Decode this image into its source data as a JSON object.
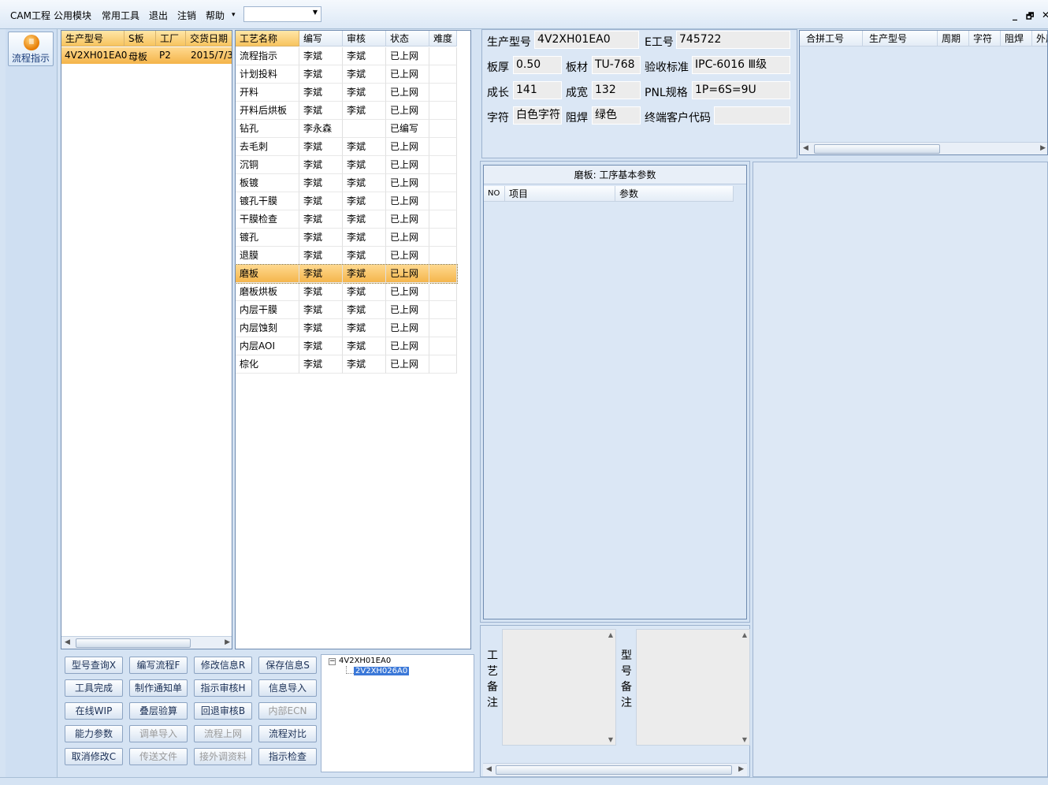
{
  "menu": {
    "items": [
      "CAM工程",
      "公用模块",
      "常用工具",
      "退出",
      "注销",
      "帮助"
    ],
    "more_arrow": "▾",
    "combo_value": "",
    "window_controls": [
      "_",
      "🗗",
      "✕"
    ]
  },
  "left_strip": {
    "flow_button_label": "流程指示"
  },
  "model_grid": {
    "columns": [
      "生产型号",
      "S板",
      "工厂",
      "交货日期"
    ],
    "rows": [
      [
        "4V2XH01EA0",
        "母板",
        "P2",
        "2015/7/3"
      ]
    ]
  },
  "process_grid": {
    "columns": [
      "工艺名称",
      "编写",
      "审核",
      "状态",
      "难度"
    ],
    "rows": [
      [
        "流程指示",
        "李斌",
        "李斌",
        "已上网",
        ""
      ],
      [
        "计划投料",
        "李斌",
        "李斌",
        "已上网",
        ""
      ],
      [
        "开料",
        "李斌",
        "李斌",
        "已上网",
        ""
      ],
      [
        "开料后烘板",
        "李斌",
        "李斌",
        "已上网",
        ""
      ],
      [
        "钻孔",
        "李永森",
        "",
        "已编写",
        ""
      ],
      [
        "去毛刺",
        "李斌",
        "李斌",
        "已上网",
        ""
      ],
      [
        "沉铜",
        "李斌",
        "李斌",
        "已上网",
        ""
      ],
      [
        "板镀",
        "李斌",
        "李斌",
        "已上网",
        ""
      ],
      [
        "镀孔干膜",
        "李斌",
        "李斌",
        "已上网",
        ""
      ],
      [
        "干膜检查",
        "李斌",
        "李斌",
        "已上网",
        ""
      ],
      [
        "镀孔",
        "李斌",
        "李斌",
        "已上网",
        ""
      ],
      [
        "退膜",
        "李斌",
        "李斌",
        "已上网",
        ""
      ],
      [
        "磨板",
        "李斌",
        "李斌",
        "已上网",
        ""
      ],
      [
        "磨板烘板",
        "李斌",
        "李斌",
        "已上网",
        ""
      ],
      [
        "内层干膜",
        "李斌",
        "李斌",
        "已上网",
        ""
      ],
      [
        "内层蚀刻",
        "李斌",
        "李斌",
        "已上网",
        ""
      ],
      [
        "内层AOI",
        "李斌",
        "李斌",
        "已上网",
        ""
      ],
      [
        "棕化",
        "李斌",
        "李斌",
        "已上网",
        ""
      ]
    ],
    "selected_index": 12
  },
  "info": {
    "production_model_label": "生产型号",
    "production_model": "4V2XH01EA0",
    "e_job_label": "E工号",
    "e_job": "745722",
    "thickness_label": "板厚",
    "thickness": "0.50",
    "material_label": "板材",
    "material": "TU-768",
    "standard_label": "验收标准",
    "standard": "IPC-6016 Ⅲ级",
    "length_label": "成长",
    "length": "141",
    "width_label": "成宽",
    "width": "132",
    "pnl_label": "PNL规格",
    "pnl": "1P=6S=9U",
    "char_label": "字符",
    "char": "白色字符",
    "mask_label": "阻焊",
    "mask": "绿色",
    "customer_code_label": "终端客户代码",
    "customer_code": ""
  },
  "merge_grid": {
    "columns": [
      "合拼工号",
      "生产型号",
      "周期",
      "字符",
      "阻焊",
      "外层"
    ]
  },
  "params_panel": {
    "title": "磨板: 工序基本参数",
    "columns": [
      "NO",
      "项目",
      "参数"
    ]
  },
  "buttons": [
    [
      "型号查询X",
      "编写流程F",
      "修改信息R",
      "保存信息S"
    ],
    [
      "工具完成",
      "制作通知单",
      "指示审核H",
      "信息导入"
    ],
    [
      "在线WIP",
      "叠层验算",
      "回退审核B",
      "内部ECN"
    ],
    [
      "能力参数",
      "调单导入",
      "流程上网",
      "流程对比"
    ],
    [
      "取消修改C",
      "传送文件",
      "接外调资料",
      "指示检查"
    ]
  ],
  "tree": {
    "root": "4V2XH01EA0",
    "child": "2V2XH026A0"
  },
  "remarks": {
    "process_label": "工艺备注",
    "model_label": "型号备注"
  }
}
